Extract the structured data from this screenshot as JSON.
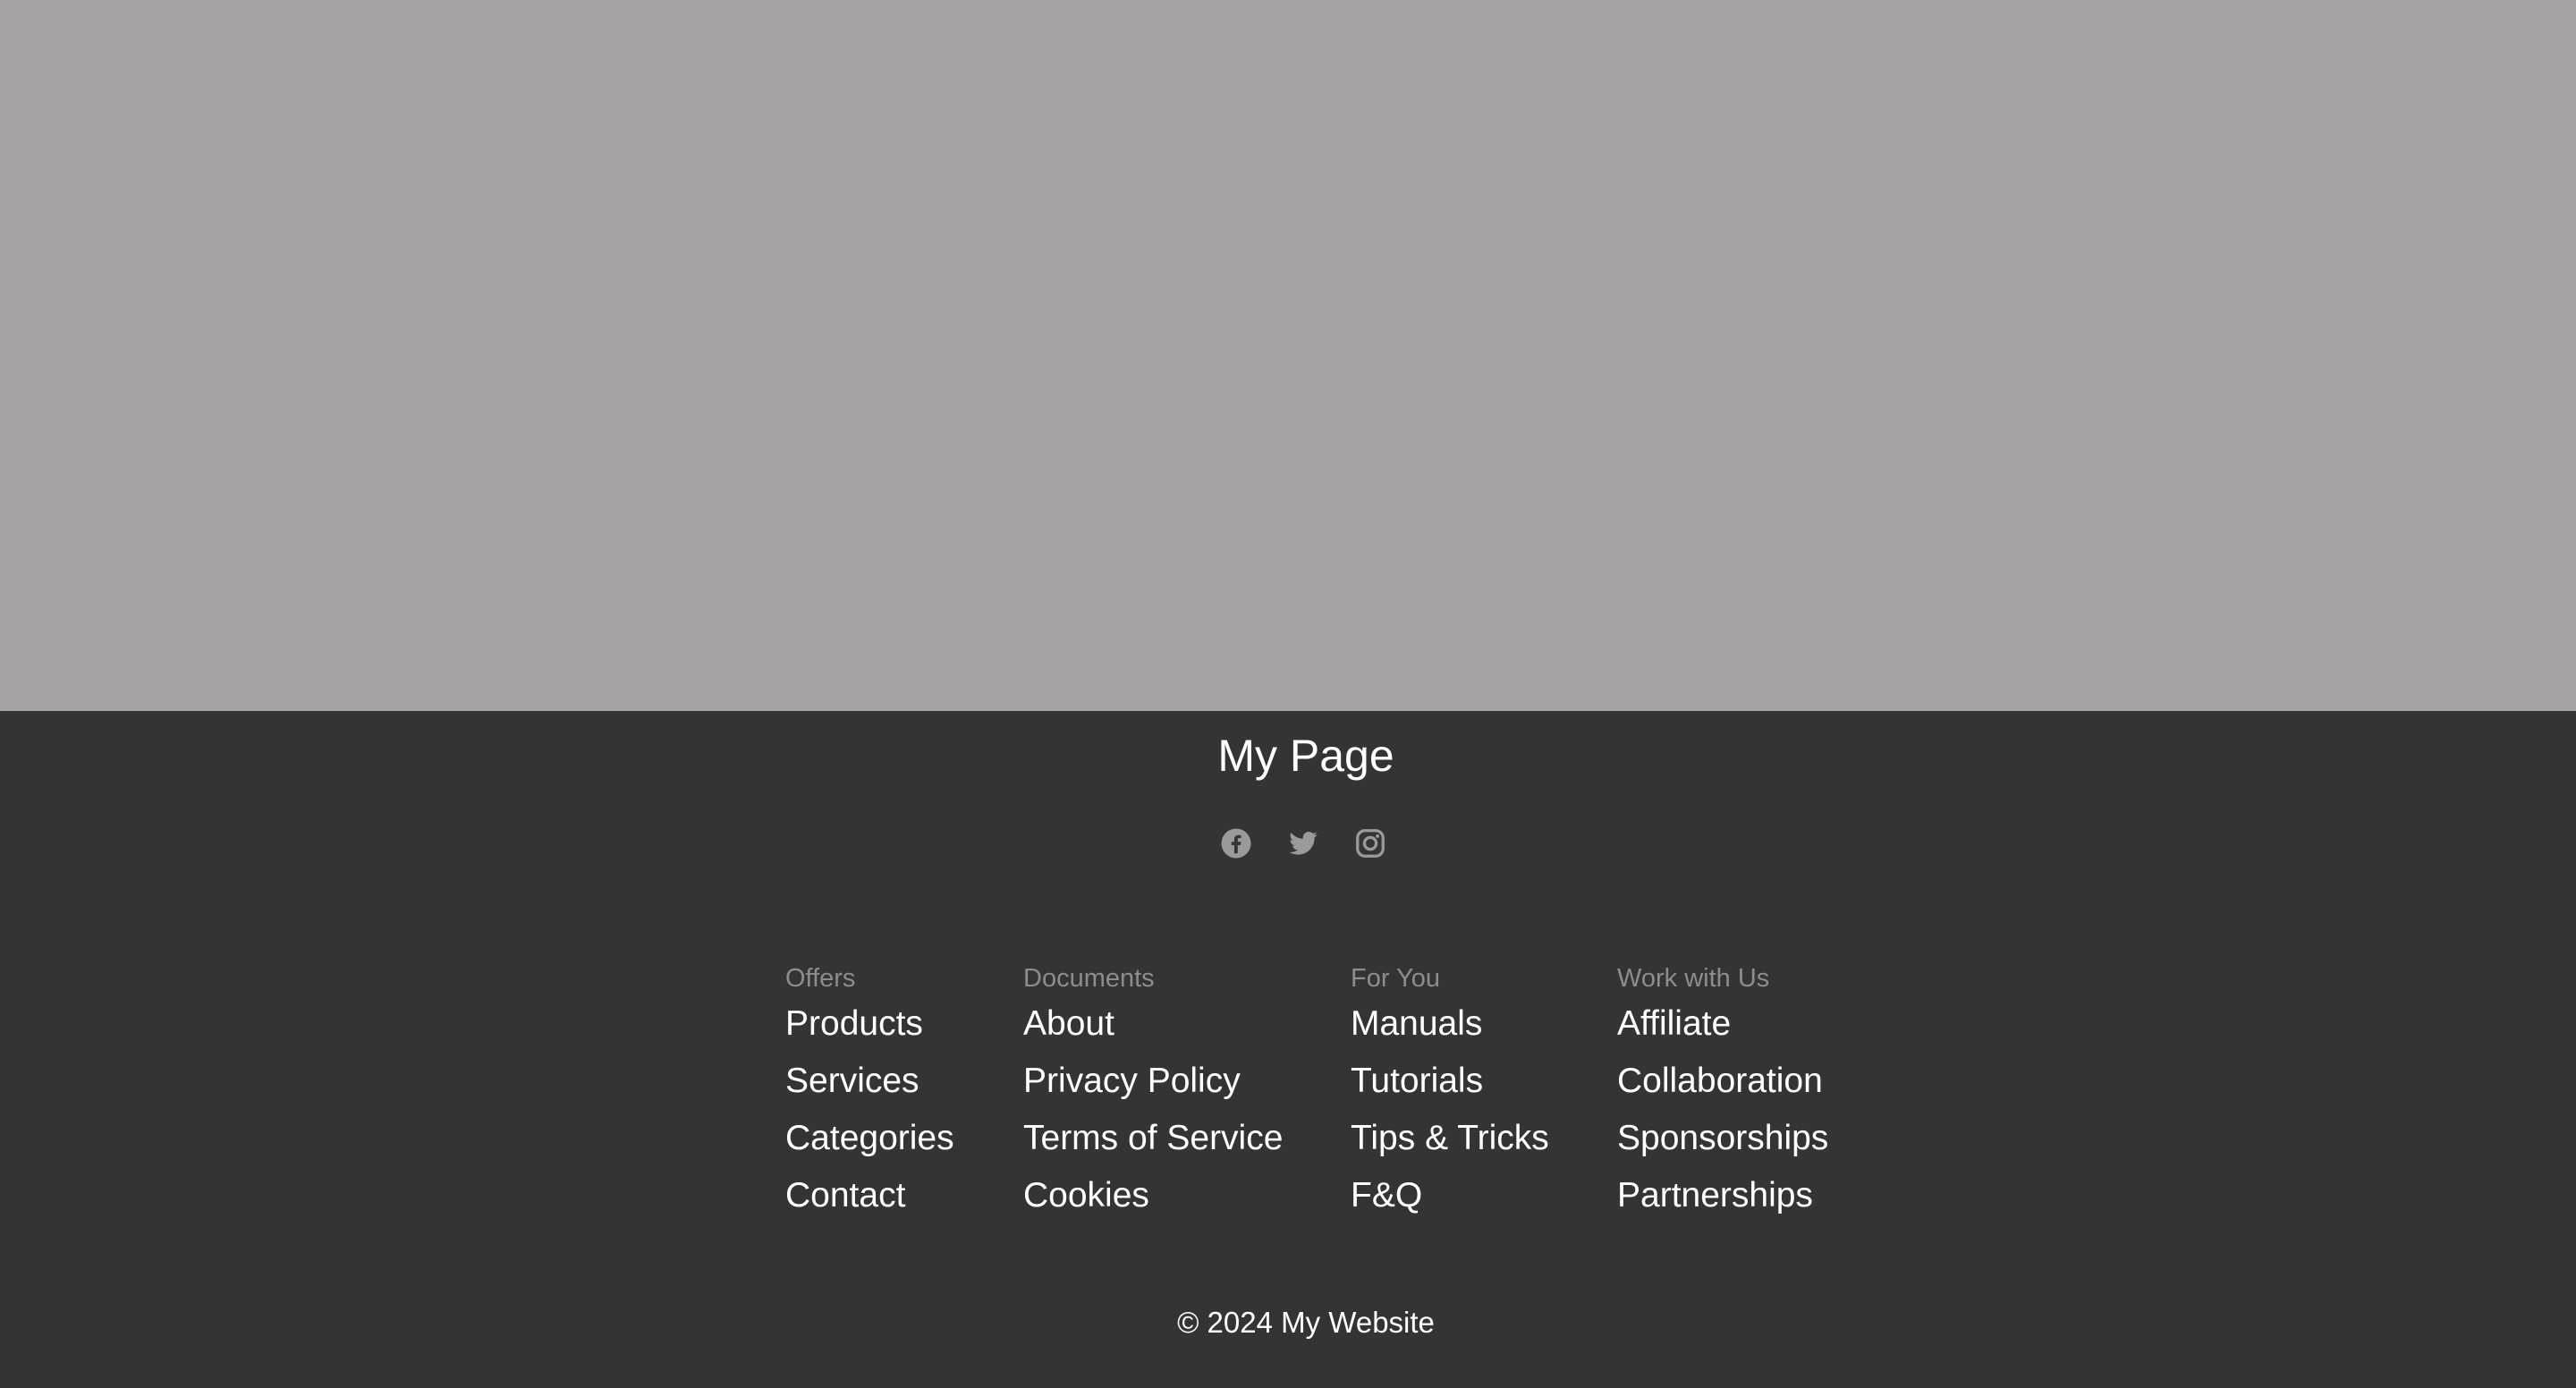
{
  "colors": {
    "hero_background": "#a5a3a4",
    "footer_background": "#343434",
    "heading_text": "#8d8d8d",
    "link_text": "#ffffff",
    "icon": "#9a9a9a"
  },
  "footer": {
    "brand": "My Page",
    "socials": [
      {
        "icon": "facebook-icon"
      },
      {
        "icon": "twitter-icon"
      },
      {
        "icon": "instagram-icon"
      }
    ],
    "columns": [
      {
        "heading": "Offers",
        "links": [
          "Products",
          "Services",
          "Categories",
          "Contact"
        ]
      },
      {
        "heading": "Documents",
        "links": [
          "About",
          "Privacy Policy",
          "Terms of Service",
          "Cookies"
        ]
      },
      {
        "heading": "For You",
        "links": [
          "Manuals",
          "Tutorials",
          "Tips & Tricks",
          "F&Q"
        ]
      },
      {
        "heading": "Work with Us",
        "links": [
          "Affiliate",
          "Collaboration",
          "Sponsorships",
          "Partnerships"
        ]
      }
    ],
    "copyright": "© 2024 My Website"
  }
}
